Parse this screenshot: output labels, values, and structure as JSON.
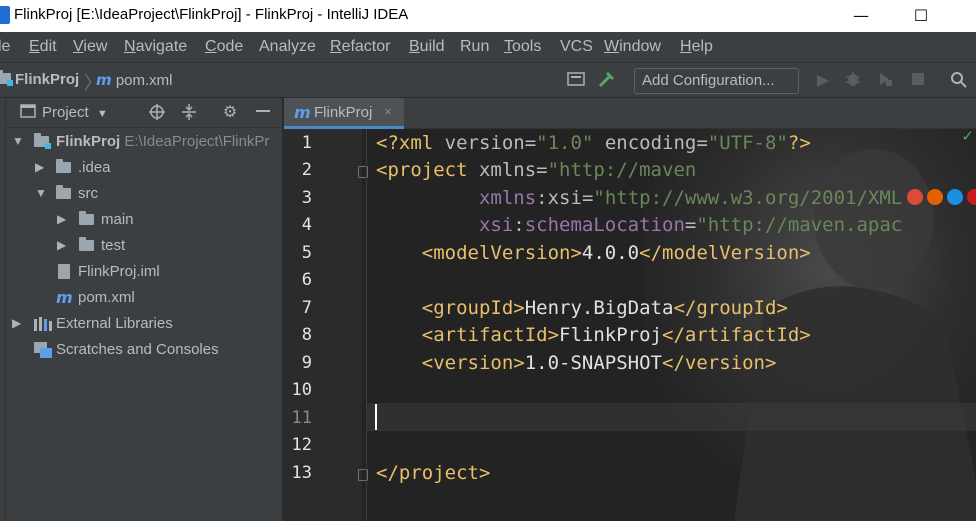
{
  "window": {
    "title": "FlinkProj [E:\\IdeaProject\\FlinkProj] - FlinkProj - IntelliJ IDEA",
    "minimize": "—",
    "maximize": "☐"
  },
  "menu": [
    {
      "label": "le",
      "u": "",
      "rest": "le"
    },
    {
      "label": "Edit",
      "u": "E",
      "rest": "dit"
    },
    {
      "label": "View",
      "u": "V",
      "rest": "iew"
    },
    {
      "label": "Navigate",
      "u": "N",
      "rest": "avigate"
    },
    {
      "label": "Code",
      "u": "C",
      "rest": "ode"
    },
    {
      "label": "Analyze",
      "u": "",
      "rest": "Analyze"
    },
    {
      "label": "Refactor",
      "u": "R",
      "rest": "efactor"
    },
    {
      "label": "Build",
      "u": "B",
      "rest": "uild"
    },
    {
      "label": "Run",
      "u": "",
      "rest": "Run"
    },
    {
      "label": "Tools",
      "u": "T",
      "rest": "ools"
    },
    {
      "label": "VCS",
      "u": "",
      "rest": "VCS"
    },
    {
      "label": "Window",
      "u": "W",
      "rest": "indow"
    },
    {
      "label": "Help",
      "u": "H",
      "rest": "elp"
    }
  ],
  "nav": {
    "project": "FlinkProj",
    "separator": "〉",
    "file_icon": "m",
    "file": "pom.xml",
    "add_configuration": "Add Configuration..."
  },
  "project_panel": {
    "title": "Project",
    "dropdown": "▼",
    "tree": [
      {
        "label": "FlinkProj",
        "path": "E:\\IdeaProject\\FlinkPr",
        "expanded": true,
        "icon": "module-folder-icon"
      },
      {
        "label": ".idea",
        "expanded": false,
        "icon": "folder-icon"
      },
      {
        "label": "src",
        "expanded": true,
        "icon": "folder-icon"
      },
      {
        "label": "main",
        "expanded": false,
        "icon": "folder-icon"
      },
      {
        "label": "test",
        "expanded": false,
        "icon": "folder-icon"
      },
      {
        "label": "FlinkProj.iml",
        "icon": "iml-file-icon"
      },
      {
        "label": "pom.xml",
        "icon": "maven-file-icon"
      },
      {
        "label": "External Libraries",
        "expanded": false,
        "icon": "libraries-icon"
      },
      {
        "label": "Scratches and Consoles",
        "icon": "scratches-icon"
      }
    ]
  },
  "editor": {
    "tab_label": "FlinkProj",
    "tab_close": "×",
    "line_numbers": [
      "1",
      "2",
      "3",
      "4",
      "5",
      "6",
      "7",
      "8",
      "9",
      "10",
      "11",
      "12",
      "13"
    ],
    "lines": {
      "l1": {
        "pi_open": "<?xml ",
        "a1": "version",
        "eq1": "=",
        "v1": "\"1.0\"",
        "sp": " ",
        "a2": "encoding",
        "eq2": "=",
        "v2": "\"UTF-8\"",
        "pi_close": "?>"
      },
      "l2": {
        "open": "<project ",
        "attr": "xmlns",
        "eq": "=",
        "val": "\"http://maven"
      },
      "l3": {
        "indent": "         ",
        "ns": "xmlns",
        "colon": ":",
        "attr": "xsi",
        "eq": "=",
        "val": "\"http://www.w3.org/2001/XML"
      },
      "l4": {
        "indent": "         ",
        "ns": "xsi",
        "colon": ":",
        "attr": "schemaLocation",
        "eq": "=",
        "val": "\"http://maven.apac"
      },
      "l5": {
        "indent": "    ",
        "open": "<modelVersion>",
        "text": "4.0.0",
        "close": "</modelVersion>"
      },
      "l7": {
        "indent": "    ",
        "open": "<groupId>",
        "text": "Henry.BigData",
        "close": "</groupId>"
      },
      "l8": {
        "indent": "    ",
        "open": "<artifactId>",
        "text": "FlinkProj",
        "close": "</artifactId>"
      },
      "l9": {
        "indent": "    ",
        "open": "<version>",
        "text": "1.0-SNAPSHOT",
        "close": "</version>"
      },
      "l13": {
        "close": "</project>"
      }
    },
    "check": "✓"
  },
  "colors": {
    "tag": "#e8bf6a",
    "value": "#6a8759",
    "namespace": "#9876aa",
    "accent": "#4a88c7"
  }
}
